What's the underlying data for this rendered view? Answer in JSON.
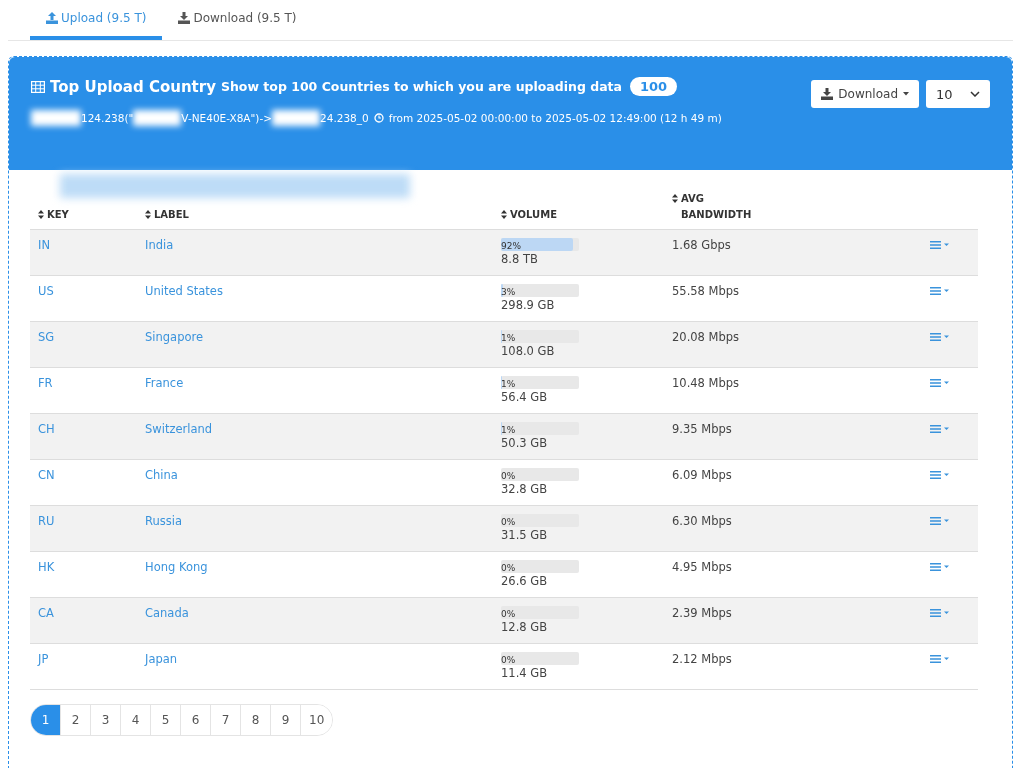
{
  "tabs": [
    {
      "label": "Upload (9.5 T)",
      "kind": "upload",
      "selected": true
    },
    {
      "label": "Download (9.5 T)",
      "kind": "download",
      "selected": false
    }
  ],
  "panel": {
    "title": "Top Upload Country",
    "subtitle": "Show top 100 Countries to which you are uploading data",
    "count": "100",
    "route_parts": [
      "124.238(\"",
      "V-NE40E-X8A\")->",
      "24.238_0"
    ],
    "time_range": "from 2025-05-02 00:00:00 to 2025-05-02 12:49:00 (12 h 49 m)",
    "download_button": "Download",
    "page_size": "10"
  },
  "table": {
    "columns": [
      "KEY",
      "LABEL",
      "VOLUME",
      "AVG BANDWIDTH"
    ],
    "rows": [
      {
        "key": "IN",
        "label": "India",
        "percent": "92%",
        "level": 0.92,
        "volume": "8.8 TB",
        "bandwidth": "1.68 Gbps"
      },
      {
        "key": "US",
        "label": "United States",
        "percent": "3%",
        "level": 0.03,
        "volume": "298.9 GB",
        "bandwidth": "55.58 Mbps"
      },
      {
        "key": "SG",
        "label": "Singapore",
        "percent": "1%",
        "level": 0.01,
        "volume": "108.0 GB",
        "bandwidth": "20.08 Mbps"
      },
      {
        "key": "FR",
        "label": "France",
        "percent": "1%",
        "level": 0.01,
        "volume": "56.4 GB",
        "bandwidth": "10.48 Mbps"
      },
      {
        "key": "CH",
        "label": "Switzerland",
        "percent": "1%",
        "level": 0.01,
        "volume": "50.3 GB",
        "bandwidth": "9.35 Mbps"
      },
      {
        "key": "CN",
        "label": "China",
        "percent": "0%",
        "level": 0,
        "volume": "32.8 GB",
        "bandwidth": "6.09 Mbps"
      },
      {
        "key": "RU",
        "label": "Russia",
        "percent": "0%",
        "level": 0,
        "volume": "31.5 GB",
        "bandwidth": "6.30 Mbps"
      },
      {
        "key": "HK",
        "label": "Hong Kong",
        "percent": "0%",
        "level": 0,
        "volume": "26.6 GB",
        "bandwidth": "4.95 Mbps"
      },
      {
        "key": "CA",
        "label": "Canada",
        "percent": "0%",
        "level": 0,
        "volume": "12.8 GB",
        "bandwidth": "2.39 Mbps"
      },
      {
        "key": "JP",
        "label": "Japan",
        "percent": "0%",
        "level": 0,
        "volume": "11.4 GB",
        "bandwidth": "2.12 Mbps"
      }
    ]
  },
  "pagination": [
    {
      "label": "1",
      "selected": true
    },
    {
      "label": "2",
      "selected": false
    },
    {
      "label": "3",
      "selected": false
    },
    {
      "label": "4",
      "selected": false
    },
    {
      "label": "5",
      "selected": false
    },
    {
      "label": "6",
      "selected": false
    },
    {
      "label": "7",
      "selected": false
    },
    {
      "label": "8",
      "selected": false
    },
    {
      "label": "9",
      "selected": false
    },
    {
      "label": "10",
      "selected": false
    }
  ]
}
